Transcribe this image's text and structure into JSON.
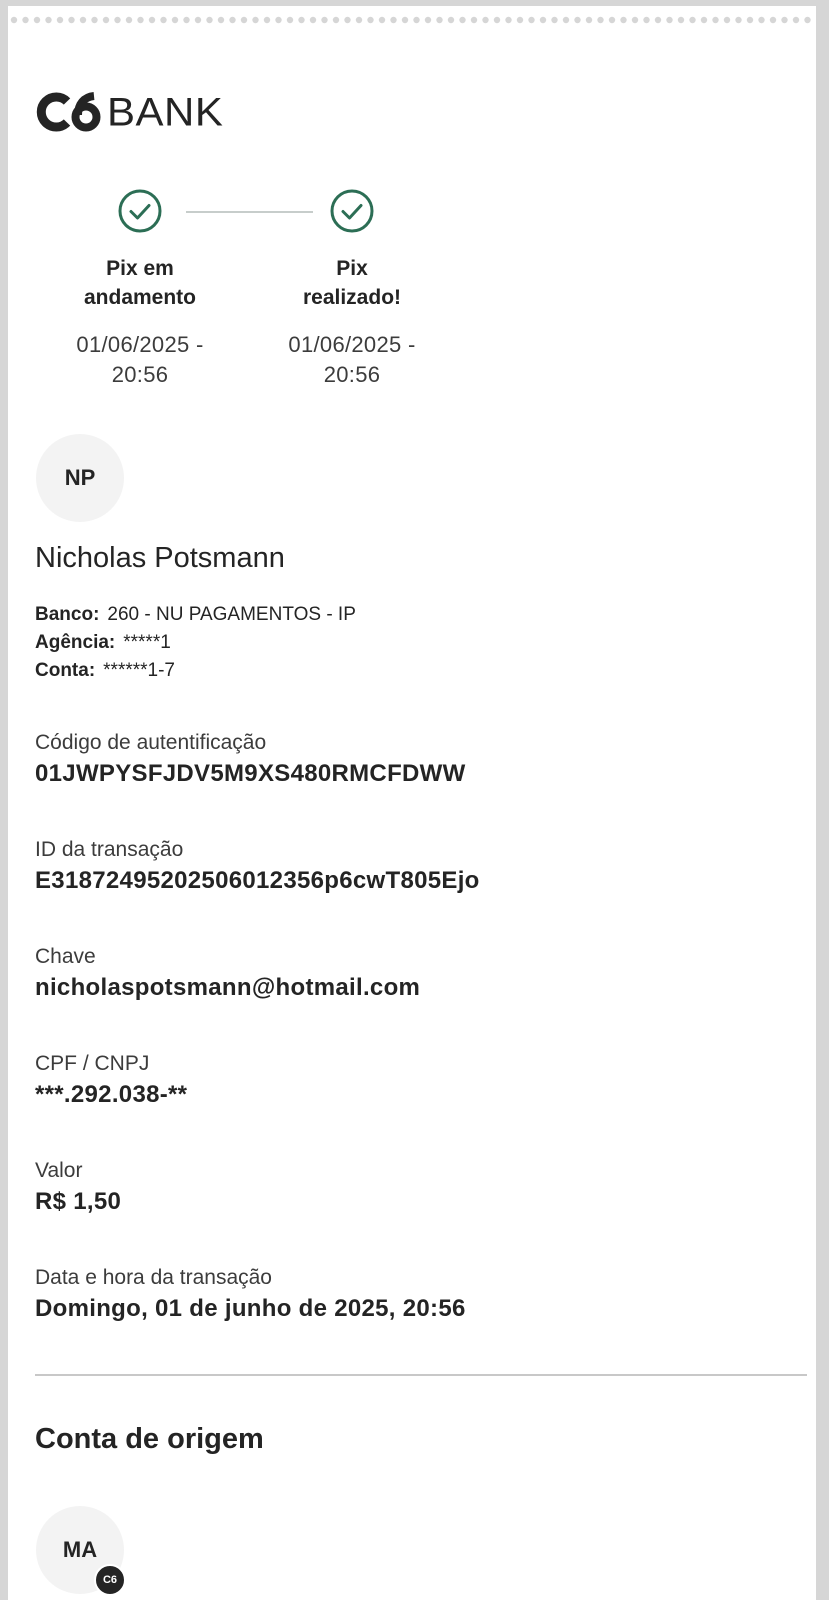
{
  "logo": {
    "mark": "C6",
    "wordmark": "BANK"
  },
  "steps": [
    {
      "title_line1": "Pix em",
      "title_line2": "andamento",
      "date_line1": "01/06/2025 -",
      "date_line2": "20:56"
    },
    {
      "title_line1": "Pix",
      "title_line2": "realizado!",
      "date_line1": "01/06/2025 -",
      "date_line2": "20:56"
    }
  ],
  "recipient": {
    "initials": "NP",
    "name": "Nicholas Potsmann",
    "bank_label": "Banco:",
    "bank_value": "260 - NU PAGAMENTOS - IP",
    "agency_label": "Agência:",
    "agency_value": "*****1",
    "account_label": "Conta:",
    "account_value": "******1-7"
  },
  "fields": [
    {
      "label": "Código de autentificação",
      "value": "01JWPYSFJDV5M9XS480RMCFDWW"
    },
    {
      "label": "ID da transação",
      "value": "E31872495202506012356p6cwT805Ejo"
    },
    {
      "label": "Chave",
      "value": "nicholaspotsmann@hotmail.com"
    },
    {
      "label": "CPF / CNPJ",
      "value": "***.292.038-**"
    },
    {
      "label": "Valor",
      "value": "R$ 1,50"
    },
    {
      "label": "Data e hora da transação",
      "value": "Domingo, 01 de junho de 2025, 20:56"
    }
  ],
  "origin": {
    "section_title": "Conta de origem",
    "initials": "MA",
    "badge": "C6"
  },
  "colors": {
    "check_green": "#2c6e55",
    "text": "#242424",
    "divider": "#c8c8c8"
  }
}
